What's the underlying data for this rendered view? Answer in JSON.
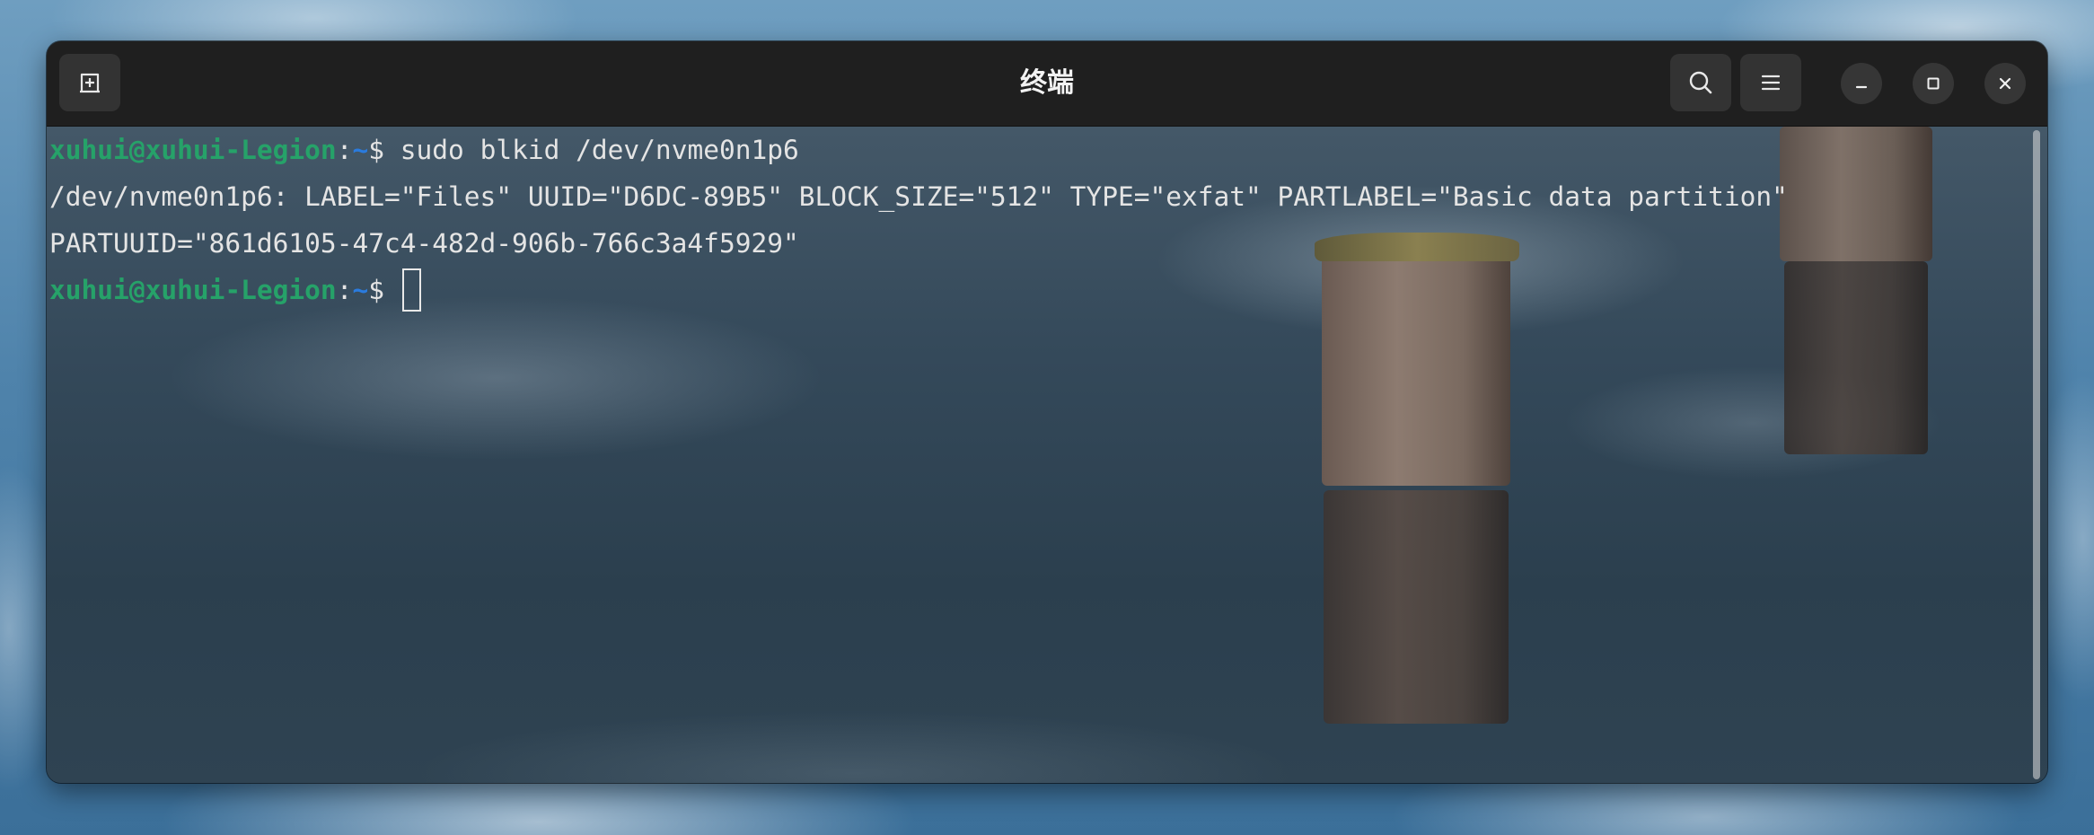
{
  "window": {
    "title": "终端"
  },
  "headerbar": {
    "new_tab_icon": "new-tab-icon",
    "search_icon": "search-icon",
    "menu_icon": "hamburger-menu-icon",
    "minimize_icon": "minimize-icon",
    "maximize_icon": "maximize-icon",
    "close_icon": "close-icon"
  },
  "terminal": {
    "lines": [
      {
        "type": "prompt",
        "user": "xuhui@xuhui-Legion",
        "sep": ":",
        "path": "~",
        "dollar": "$ ",
        "command": "sudo blkid /dev/nvme0n1p6"
      },
      {
        "type": "output",
        "text": "/dev/nvme0n1p6: LABEL=\"Files\" UUID=\"D6DC-89B5\" BLOCK_SIZE=\"512\" TYPE=\"exfat\" PARTLABEL=\"Basic data partition\""
      },
      {
        "type": "output",
        "text": "PARTUUID=\"861d6105-47c4-482d-906b-766c3a4f5929\""
      },
      {
        "type": "prompt",
        "user": "xuhui@xuhui-Legion",
        "sep": ":",
        "path": "~",
        "dollar": "$ ",
        "command": ""
      }
    ]
  },
  "colors": {
    "prompt_user": "#26a269",
    "prompt_path": "#2a7bde",
    "text": "#e4e4e4",
    "headerbar": "#1f1f1f"
  }
}
